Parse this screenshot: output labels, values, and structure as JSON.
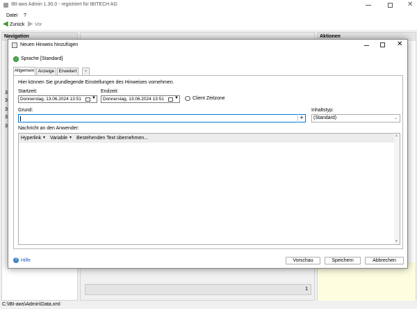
{
  "app": {
    "title": "IBI-aws Admin 1.30.0 - registriert für IBITECH AG",
    "menu": [
      "Datei",
      "?"
    ],
    "toolbar": {
      "back": "Zurück",
      "forward": "Vor"
    },
    "left_panel_title": "Navigation",
    "right_panel_title": "Aktionen",
    "status_path": "C:\\IBI-aws\\Admin\\Data.xml",
    "page_number": "1",
    "left_nav_fragments": [
      "3",
      "3",
      "3",
      "3",
      "3"
    ]
  },
  "dialog": {
    "title": "Neuen Hinweis hinzufügen",
    "language": "Sprache [Standard]",
    "tabs": [
      "Allgemein",
      "Anzeige",
      "Erweitert",
      "+"
    ],
    "description": "Hier können Sie grundlegende Einstellungen des Hinweises vornehmen.",
    "start_label": "Startzeit:",
    "start_value": "Donnerstag, 13.06.2024   13:51",
    "end_label": "Endzeit:",
    "end_value": "Donnerstag, 13.06.2024   13:51",
    "client_tz": "Client Zeitzone",
    "reason_label": "Grund:",
    "reason_value": "",
    "content_type_label": "Inhaltstyp:",
    "content_type_value": "(Standard)",
    "message_label": "Nachricht an den Anwender:",
    "editor_toolbar": {
      "hyperlink": "Hyperlink",
      "variable": "Variable",
      "existing": "Bestehenden Text übernehmen..."
    },
    "help": "Hilfe",
    "buttons": {
      "preview": "Vorschau",
      "save": "Speichern",
      "cancel": "Abbrechen"
    }
  }
}
